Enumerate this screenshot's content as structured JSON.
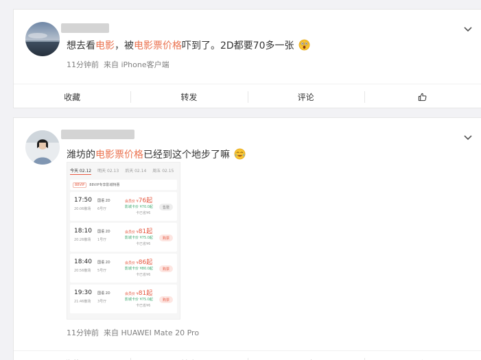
{
  "posts": [
    {
      "text_before": "想去看",
      "hl1": "电影",
      "text_mid": "，被",
      "hl2": "电影票价格",
      "text_after": "吓到了。2D都要70多一张",
      "time": "11分钟前",
      "source": "来自 iPhone客户端",
      "actions": {
        "favorite": "收藏",
        "repost": "转发",
        "comment": "评论"
      }
    },
    {
      "text_before": "潍坊的",
      "hl": "电影票价格",
      "text_after": "已经到这个地步了嘛",
      "time": "11分钟前",
      "source": "来自 HUAWEI Mate 20 Pro",
      "actions": {
        "favorite": "收藏",
        "repost": "转发",
        "comment": "评论"
      }
    }
  ],
  "screenshot": {
    "dates": [
      "今天 02.12",
      "明天 02.13",
      "后天 02.14",
      "周五 02.15"
    ],
    "vip_badge": "88VIP",
    "vip_text": "88VIP专享影城特惠",
    "showtimes": [
      {
        "start": "17:50",
        "end": "20:06散场",
        "lang": "国语 2D",
        "hall": "6号厅",
        "price_label": "会员价 ¥",
        "price": "76起",
        "card_price": "影城卡价 ¥70.0起",
        "discount": "卡已省¥6",
        "button": "售罄",
        "button_style": "gray"
      },
      {
        "start": "18:10",
        "end": "20:26散场",
        "lang": "国语 2D",
        "hall": "1号厅",
        "price_label": "会员价 ¥",
        "price": "81起",
        "card_price": "影城卡价 ¥75.0起",
        "discount": "卡已省¥6",
        "button": "购票",
        "button_style": "red"
      },
      {
        "start": "18:40",
        "end": "20:56散场",
        "lang": "国语 2D",
        "hall": "5号厅",
        "price_label": "会员价 ¥",
        "price": "86起",
        "card_price": "影城卡价 ¥80.0起",
        "discount": "卡已省¥6",
        "button": "购票",
        "button_style": "red"
      },
      {
        "start": "19:30",
        "end": "21:46散场",
        "lang": "国语 2D",
        "hall": "3号厅",
        "price_label": "会员价 ¥",
        "price": "81起",
        "card_price": "影城卡价 ¥75.0起",
        "discount": "卡已省¥6",
        "button": "购票",
        "button_style": "red"
      }
    ]
  },
  "icons": [
    "chevron-down-icon",
    "like-icon",
    "shocked-face-emoji-icon",
    "tearful-face-emoji-icon"
  ],
  "colors": {
    "highlight": "#eb7350",
    "meta": "#808080",
    "background": "#f2f2f5"
  }
}
